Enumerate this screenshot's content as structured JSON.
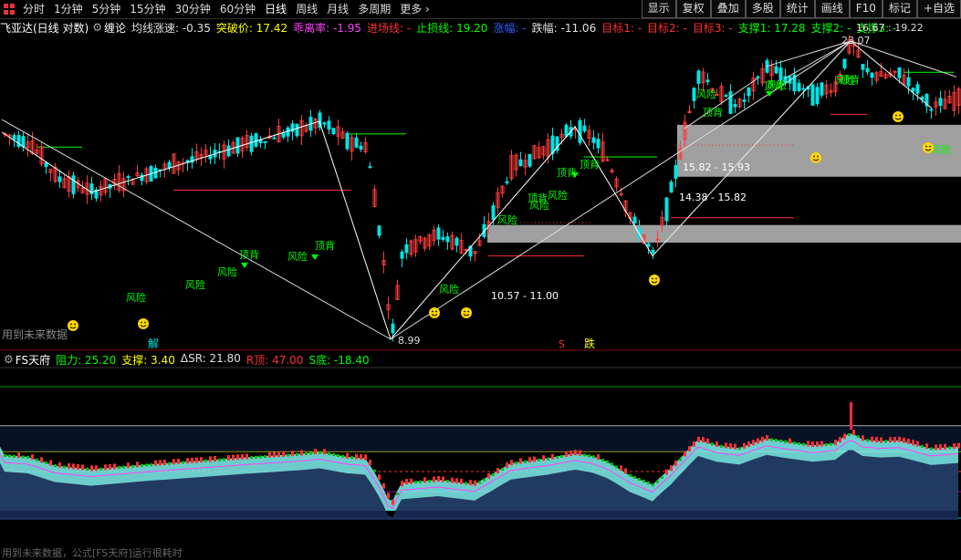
{
  "toolbar": {
    "periods": [
      "分时",
      "1分钟",
      "5分钟",
      "15分钟",
      "30分钟",
      "60分钟",
      "日线",
      "周线",
      "月线",
      "多周期",
      "更多"
    ],
    "active_period": "日线",
    "right_buttons": [
      "显示",
      "复权",
      "叠加",
      "多股",
      "统计",
      "画线",
      "F10",
      "标记",
      "+自选"
    ]
  },
  "info": {
    "stock": "飞亚达(日线 对数)",
    "indicator": "缠论",
    "items": [
      {
        "label": "均线涨速:",
        "value": "-0.35",
        "color": "#e0e0e0"
      },
      {
        "label": "突破价:",
        "value": "17.42",
        "color": "#ffff00"
      },
      {
        "label": "乖离率:",
        "value": "-1.95",
        "color": "#ff40ff"
      },
      {
        "label": "进场线:",
        "value": "-",
        "color": "#ff3030"
      },
      {
        "label": "止损线:",
        "value": "19.20",
        "color": "#00ff00"
      },
      {
        "label": "涨幅:",
        "value": "-",
        "color": "#3060ff"
      },
      {
        "label": "跌幅:",
        "value": "-11.06",
        "color": "#e0e0e0"
      },
      {
        "label": "目标1:",
        "value": "-",
        "color": "#ff3030"
      },
      {
        "label": "目标2:",
        "value": "-",
        "color": "#ff3030"
      },
      {
        "label": "目标3:",
        "value": "-",
        "color": "#ff3030"
      },
      {
        "label": "支撑1:",
        "value": "17.28",
        "color": "#00ff00"
      },
      {
        "label": "支撑2:",
        "value": "-",
        "color": "#00ff00"
      },
      {
        "label": "支撑3:",
        "value": "-",
        "color": "#00ff00"
      }
    ]
  },
  "chart_labels": {
    "high": "23.07",
    "high_right": "16.67 : 19.22",
    "low": "8.99",
    "zone1": "15.82 - 15.93",
    "zone2": "14.38 - 15.82",
    "zone3": "10.57 - 11.00",
    "risk": "风险",
    "top_div": "顶背",
    "jie": "解",
    "die": "跌",
    "s_mark": "S"
  },
  "future_note": "用到未来数据",
  "indicator2": {
    "name": "FS天府",
    "items": [
      {
        "label": "阻力:",
        "value": "25.20",
        "color": "#00ff00"
      },
      {
        "label": "支撑:",
        "value": "3.40",
        "color": "#ffff00"
      },
      {
        "label": "ΔSR:",
        "value": "21.80",
        "color": "#e0e0e0"
      },
      {
        "label": "R顶:",
        "value": "47.00",
        "color": "#ff3030"
      },
      {
        "label": "S底:",
        "value": "-18.40",
        "color": "#00ff00"
      }
    ]
  },
  "bottom_note": "用到未来数据，公式[FS天府]运行很耗时",
  "colors": {
    "up": "#ff3b3b",
    "down": "#00e5e5",
    "ma": "#ffffff",
    "green": "#00ff00",
    "yellow": "#ffff00",
    "magenta": "#ff00ff",
    "cyan": "#7ff0f0"
  }
}
